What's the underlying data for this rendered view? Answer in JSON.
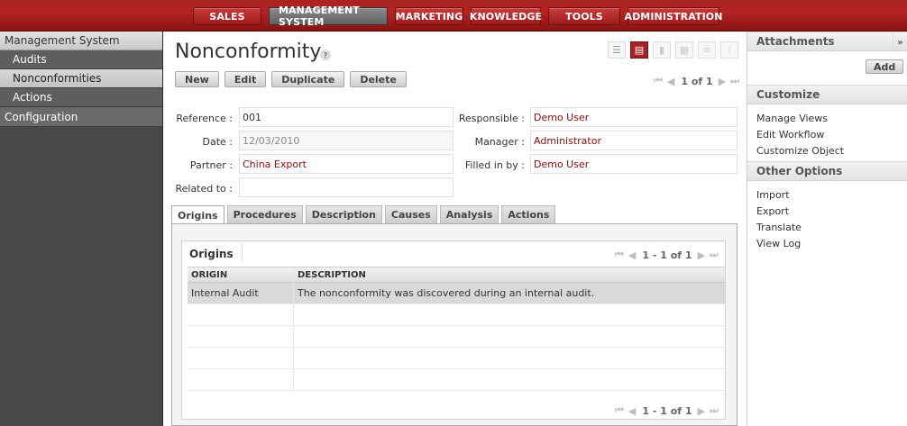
{
  "topnav": {
    "items": [
      "SALES",
      "MANAGEMENT SYSTEM",
      "MARKETING",
      "KNOWLEDGE",
      "TOOLS",
      "ADMINISTRATION"
    ],
    "active": "MANAGEMENT SYSTEM"
  },
  "sidebar": {
    "section": "Management System",
    "items": [
      "Audits",
      "Nonconformities",
      "Actions"
    ],
    "selected": "Nonconformities",
    "section2": "Configuration"
  },
  "page": {
    "title": "Nonconformity",
    "help": "?",
    "views": [
      "list-view-icon",
      "form-view-icon",
      "graph-view-icon",
      "calendar-view-icon",
      "gantt-view-icon",
      "diagram-view-icon"
    ]
  },
  "toolbar": {
    "new": "New",
    "edit": "Edit",
    "duplicate": "Duplicate",
    "delete": "Delete"
  },
  "pager": {
    "count": "1 of 1"
  },
  "form": {
    "reference_label": "Reference :",
    "reference": "001",
    "date_label": "Date :",
    "date": "12/03/2010",
    "partner_label": "Partner :",
    "partner": "China Export",
    "related_label": "Related to :",
    "related": "",
    "responsible_label": "Responsible :",
    "responsible": "Demo User",
    "manager_label": "Manager :",
    "manager": "Administrator",
    "filled_label": "Filled in by :",
    "filled": "Demo User"
  },
  "tabs": [
    "Origins",
    "Procedures",
    "Description",
    "Causes",
    "Analysis",
    "Actions"
  ],
  "origins": {
    "title": "Origins",
    "pager": "1 - 1 of 1",
    "columns": [
      "ORIGIN",
      "DESCRIPTION"
    ],
    "rows": [
      [
        "Internal Audit",
        "The nonconformity was discovered during an internal audit."
      ]
    ]
  },
  "right": {
    "attachments": "Attachments",
    "collapse": "»",
    "add": "Add",
    "customize": "Customize",
    "customize_links": [
      "Manage Views",
      "Edit Workflow",
      "Customize Object"
    ],
    "other": "Other Options",
    "other_links": [
      "Import",
      "Export",
      "Translate",
      "View Log"
    ]
  },
  "colors": {
    "brand": "#a52323",
    "link": "#8a0b0b",
    "sidebar": "#484848"
  }
}
